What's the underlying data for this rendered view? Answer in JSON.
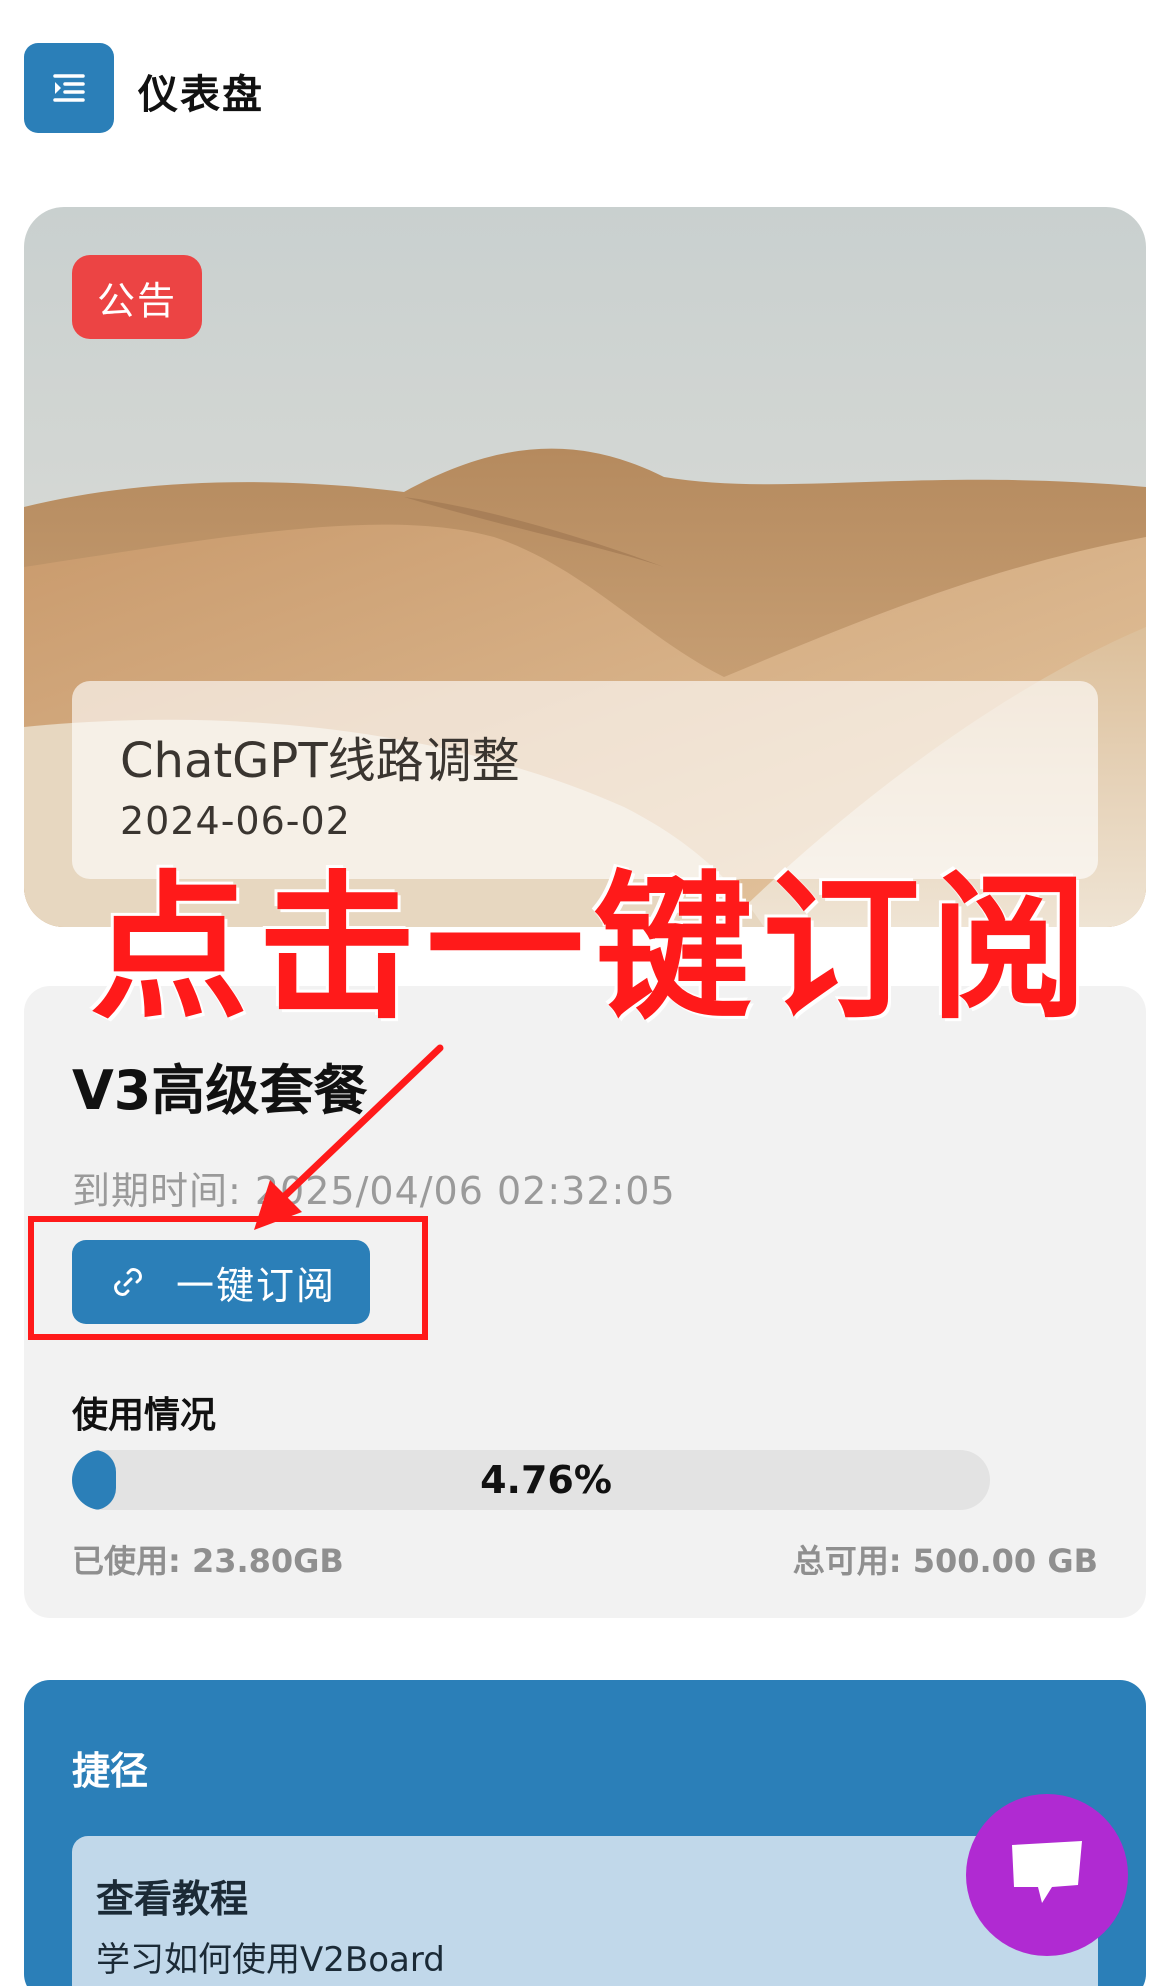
{
  "header": {
    "title": "仪表盘",
    "menu_icon": "menu-icon"
  },
  "announcement": {
    "badge": "公告",
    "title": "ChatGPT线路调整",
    "date": "2024-06-02"
  },
  "annotation": {
    "text": "点击一键订阅",
    "color": "#ff1a1a"
  },
  "subscription": {
    "plan_name": "V3高级套餐",
    "expiry_text": "到期时间: 2025/04/06 02:32:05",
    "subscribe_button": "一键订阅",
    "usage_title": "使用情况",
    "usage_percent": 4.76,
    "usage_percent_text": "4.76%",
    "used_text": "已使用: 23.80GB",
    "total_text": "总可用: 500.00 GB"
  },
  "shortcuts": {
    "title": "捷径",
    "items": [
      {
        "title": "查看教程",
        "description": "学习如何使用V2Board"
      }
    ]
  },
  "colors": {
    "primary": "#2b7fb8",
    "badge_red": "#ec4444",
    "chat_purple": "#b02ad2"
  }
}
